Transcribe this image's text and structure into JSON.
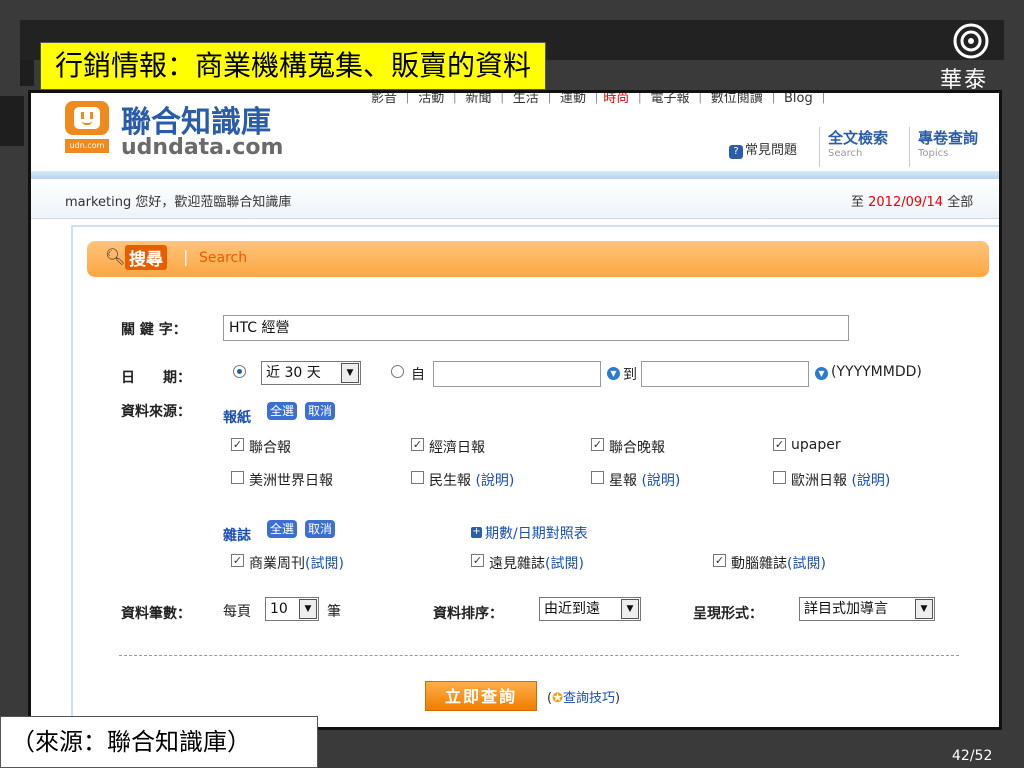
{
  "slide": {
    "title": "行銷情報：商業機構蒐集、販賣的資料",
    "source": "（來源：聯合知識庫）",
    "page": "42/52",
    "logo_text": "華泰"
  },
  "site": {
    "name": "聯合知識庫",
    "url": "udndata.com",
    "tag": "udn.com",
    "top_links": "影音 ｜ 活動 ｜ 新聞 ｜ 生活 ｜ 運動 ｜",
    "top_links_hot": "時尚",
    "top_links_tail": " ｜ 電子報 ｜ 數位閱讀 ｜ Blog ｜",
    "faq_icon": "?",
    "faq": "常見問題",
    "nav": [
      {
        "label": "全文檢索",
        "sub": "Search"
      },
      {
        "label": "專卷查詢",
        "sub": "Topics"
      }
    ]
  },
  "welcome": {
    "text": "marketing 您好，歡迎蒞臨聯合知識庫",
    "date_prefix": "至 ",
    "date": "2012/09/14",
    "date_suffix": " 全部"
  },
  "search": {
    "title": "搜尋",
    "sub": "Search",
    "keyword_label": "關 鍵 字：",
    "keyword_value": "HTC 經營",
    "date_label": "日　　期：",
    "date_range": "近 30 天",
    "from": "自",
    "to": "到",
    "date_format": "(YYYYMMDD)",
    "source_label": "資料來源：",
    "newspaper_group": "報紙",
    "select_all": "全選",
    "cancel": "取消",
    "newspapers": [
      {
        "label": "聯合報",
        "checked": true
      },
      {
        "label": "經濟日報",
        "checked": true
      },
      {
        "label": "聯合晚報",
        "checked": true
      },
      {
        "label": "upaper",
        "checked": true
      },
      {
        "label": "美洲世界日報",
        "checked": false
      },
      {
        "label": "民生報",
        "checked": false,
        "extra": "(說明)"
      },
      {
        "label": "星報",
        "checked": false,
        "extra": "(說明)"
      },
      {
        "label": "歐洲日報",
        "checked": false,
        "extra": "(說明)"
      }
    ],
    "magazine_group": "雜誌",
    "issue_table": "期數/日期對照表",
    "magazines": [
      {
        "label": "商業周刊",
        "checked": true,
        "extra": "(試閱)"
      },
      {
        "label": "遠見雜誌",
        "checked": true,
        "extra": "(試閱)"
      },
      {
        "label": "動腦雜誌",
        "checked": true,
        "extra": "(試閱)"
      }
    ],
    "count_label": "資料筆數：",
    "per_page": "每頁",
    "per_page_value": "10",
    "per_page_unit": "筆",
    "sort_label": "資料排序：",
    "sort_value": "由近到遠",
    "format_label": "呈現形式：",
    "format_value": "詳目式加導言",
    "submit": "立即查詢",
    "tips_open": "(",
    "tips": "查詢技巧",
    "tips_close": ")",
    "check_mark": "✓",
    "arrow": "▼"
  }
}
